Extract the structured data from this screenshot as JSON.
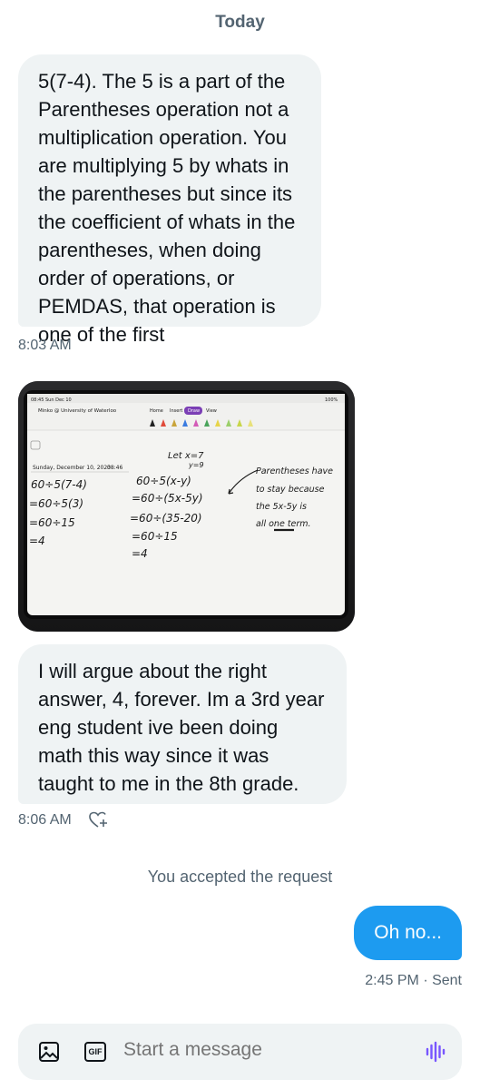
{
  "day_separator": "Today",
  "messages": [
    {
      "direction": "received",
      "text": "5(7-4). The 5 is a part of the Parentheses operation not a multiplication operation. You are multiplying 5 by whats in the parentheses but since its the coefficient of whats in the parentheses, when doing order of operations, or PEMDAS, that operation is one of the first",
      "time": "8:03 AM"
    },
    {
      "direction": "received",
      "type": "image",
      "image": {
        "status_left": "08:45  Sun Dec 10",
        "status_right": "100%",
        "doc_title": "Minko @ University of Waterloo",
        "tabs": [
          "Home",
          "Insert",
          "Draw",
          "View"
        ],
        "active_tab": "Draw",
        "date_line": "Sunday, December 10, 2023",
        "time_line": "08:46",
        "given_1": "Let x=7",
        "given_2": "y=9",
        "col1": [
          "60÷5(7-4)",
          "=60÷5(3)",
          "=60÷15",
          "=4"
        ],
        "col2": [
          "60÷5(x-y)",
          "=60÷(5x-5y)",
          "=60÷(35-20)",
          "=60÷15",
          "=4"
        ],
        "note_lines": [
          "Parentheses have",
          "to stay because",
          "the 5x-5y is",
          "all one term."
        ]
      }
    },
    {
      "direction": "received",
      "text": "I will argue about the right answer, 4, forever. Im a 3rd year eng student ive been doing math this way since it was taught to me in the 8th grade.",
      "time": "8:06 AM"
    },
    {
      "type": "system",
      "text": "You accepted the request"
    },
    {
      "direction": "sent",
      "text": "Oh no...",
      "time": "2:45 PM · Sent"
    }
  ],
  "composer": {
    "placeholder": "Start a message",
    "gif_label": "GIF",
    "icons": [
      "image-icon",
      "gif-icon",
      "voice-icon"
    ]
  },
  "colors": {
    "accent": "#1d9bf0",
    "received_bubble": "#eff3f4",
    "voice_icon": "#7856ff"
  }
}
